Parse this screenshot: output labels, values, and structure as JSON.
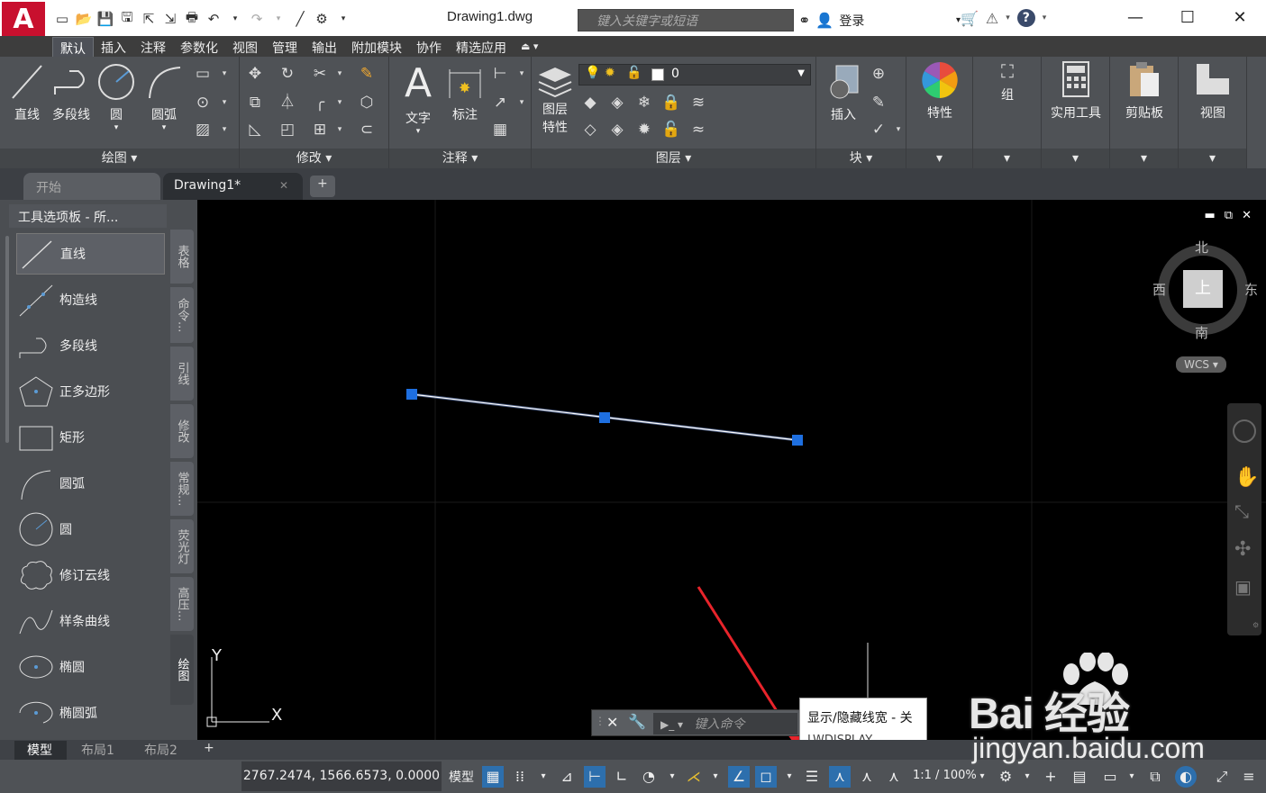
{
  "app": {
    "logo": "A",
    "document_title": "Drawing1.dwg",
    "search_placeholder": "键入关键字或短语",
    "login_label": "登录",
    "window_controls": [
      "minimize-icon",
      "maximize-icon",
      "close-icon"
    ]
  },
  "ribbon_tabs": [
    {
      "label": "默认",
      "active": true
    },
    {
      "label": "插入"
    },
    {
      "label": "注释"
    },
    {
      "label": "参数化"
    },
    {
      "label": "视图"
    },
    {
      "label": "管理"
    },
    {
      "label": "输出"
    },
    {
      "label": "附加模块"
    },
    {
      "label": "协作"
    },
    {
      "label": "精选应用"
    }
  ],
  "ribbon": {
    "draw": {
      "footer": "绘图 ▾",
      "tools": [
        "直线",
        "多段线",
        "圆",
        "圆弧"
      ]
    },
    "modify": {
      "footer": "修改 ▾"
    },
    "annotation": {
      "footer": "注释 ▾",
      "tools": [
        "文字",
        "标注"
      ]
    },
    "layers": {
      "footer": "图层 ▾",
      "tool_line1": "图层",
      "tool_line2": "特性",
      "current_layer": "0"
    },
    "block": {
      "footer": "块 ▾",
      "tool": "插入"
    },
    "properties": {
      "tool": "特性"
    },
    "groups": {
      "tool": "组"
    },
    "utilities": {
      "tool": "实用工具"
    },
    "clipboard": {
      "tool": "剪贴板"
    },
    "view": {
      "tool": "视图"
    }
  },
  "file_tabs": [
    {
      "label": "开始"
    },
    {
      "label": "Drawing1*",
      "active": true,
      "close": "✕"
    },
    {
      "label": "+"
    }
  ],
  "palette": {
    "title": "工具选项板 - 所...",
    "items": [
      "直线",
      "构造线",
      "多段线",
      "正多边形",
      "矩形",
      "圆弧",
      "圆",
      "修订云线",
      "样条曲线",
      "椭圆",
      "椭圆弧"
    ],
    "side_tabs": [
      "表格",
      "命令...",
      "引线",
      "修改",
      "常规...",
      "荧光灯",
      "高压...",
      "绘图"
    ]
  },
  "viewcube": {
    "north": "北",
    "south": "南",
    "east": "东",
    "west": "西",
    "face": "上",
    "wcs": "WCS"
  },
  "ucs": {
    "x": "X",
    "y": "Y"
  },
  "command_line": {
    "placeholder": "键入命令"
  },
  "tooltip": {
    "title": "显示/隐藏线宽 - 关",
    "command": "LWDISPLAY"
  },
  "layout_tabs": [
    {
      "label": "模型",
      "active": true
    },
    {
      "label": "布局1"
    },
    {
      "label": "布局2"
    },
    {
      "label": "+"
    }
  ],
  "status_bar": {
    "coordinates": "2767.2474, 1566.6573, 0.0000",
    "model": "模型",
    "scale": "1:1 / 100%"
  },
  "watermark": {
    "brand": "Bai  经验",
    "url": "jingyan.baidu.com"
  },
  "colors": {
    "accent": "#2d6fad",
    "selection_grip": "#1e6fe0",
    "arrow": "#e8242b",
    "logo_red": "#c8102e"
  }
}
